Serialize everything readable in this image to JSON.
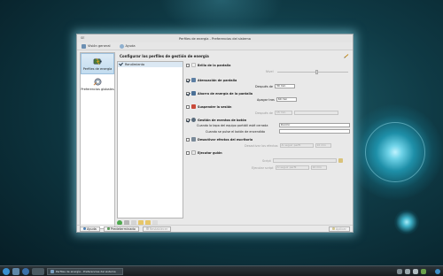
{
  "window": {
    "title": "Perfiles de energía - Preferencias del sistema",
    "app_corner": "SE"
  },
  "toolbar": {
    "overview_label": "Visión general",
    "help_label": "Ayuda"
  },
  "sidebar": {
    "items": [
      {
        "label": "Perfiles de energía",
        "icon": "battery-icon",
        "active": true
      },
      {
        "label": "Preferencias globales",
        "icon": "gear-icon",
        "active": false
      }
    ]
  },
  "content": {
    "heading": "Configurar los perfiles de gestión de energía",
    "profiles": [
      "Rendimiento"
    ]
  },
  "settings": {
    "brightness": {
      "label": "Brillo de la pantalla",
      "checked": false,
      "level_label": "Nivel",
      "level": 0.55
    },
    "dim": {
      "label": "Atenuación de pantalla",
      "checked": true,
      "after_label": "Después de",
      "after_value": "30 min"
    },
    "dpms": {
      "label": "Ahorro de energía de la pantalla",
      "checked": true,
      "off_label": "Apagar tras",
      "off_value": "60 min"
    },
    "suspend": {
      "label": "Suspender la sesión",
      "checked": false,
      "after_label": "Después de",
      "after_value": "15 min"
    },
    "buttons": {
      "label": "Gestión de eventos de botón",
      "checked": true,
      "lid_label": "Cuando la tapa del equipo portátil esté cerrada",
      "lid_value": "Dormir",
      "power_label": "Cuando se pulse el botón de encendido",
      "power_value": ""
    },
    "effects": {
      "label": "Desactivar efectos del escritorio",
      "checked": false,
      "when_label": "Desactivar los efectos",
      "when_value": "Al seguir perfil",
      "after_value": "10 min"
    },
    "script": {
      "label": "Ejecutar guión",
      "checked": false,
      "script_label": "Script",
      "run_label": "Ejecutar script",
      "run_value": "Al seguir perfil",
      "after_value": "10 min"
    }
  },
  "bottom": {
    "help_label": "Ayuda",
    "default_label": "Predeterminado",
    "reset_label": "Restablecer",
    "apply_label": "Aplicar"
  },
  "taskbar": {
    "task_label": "Perfiles de energía - Preferencias del sistema",
    "clock": ""
  },
  "colors": {
    "accent": "#3d8fc7",
    "desktop": "#0f3a45",
    "glow": "#8fdcf0"
  }
}
